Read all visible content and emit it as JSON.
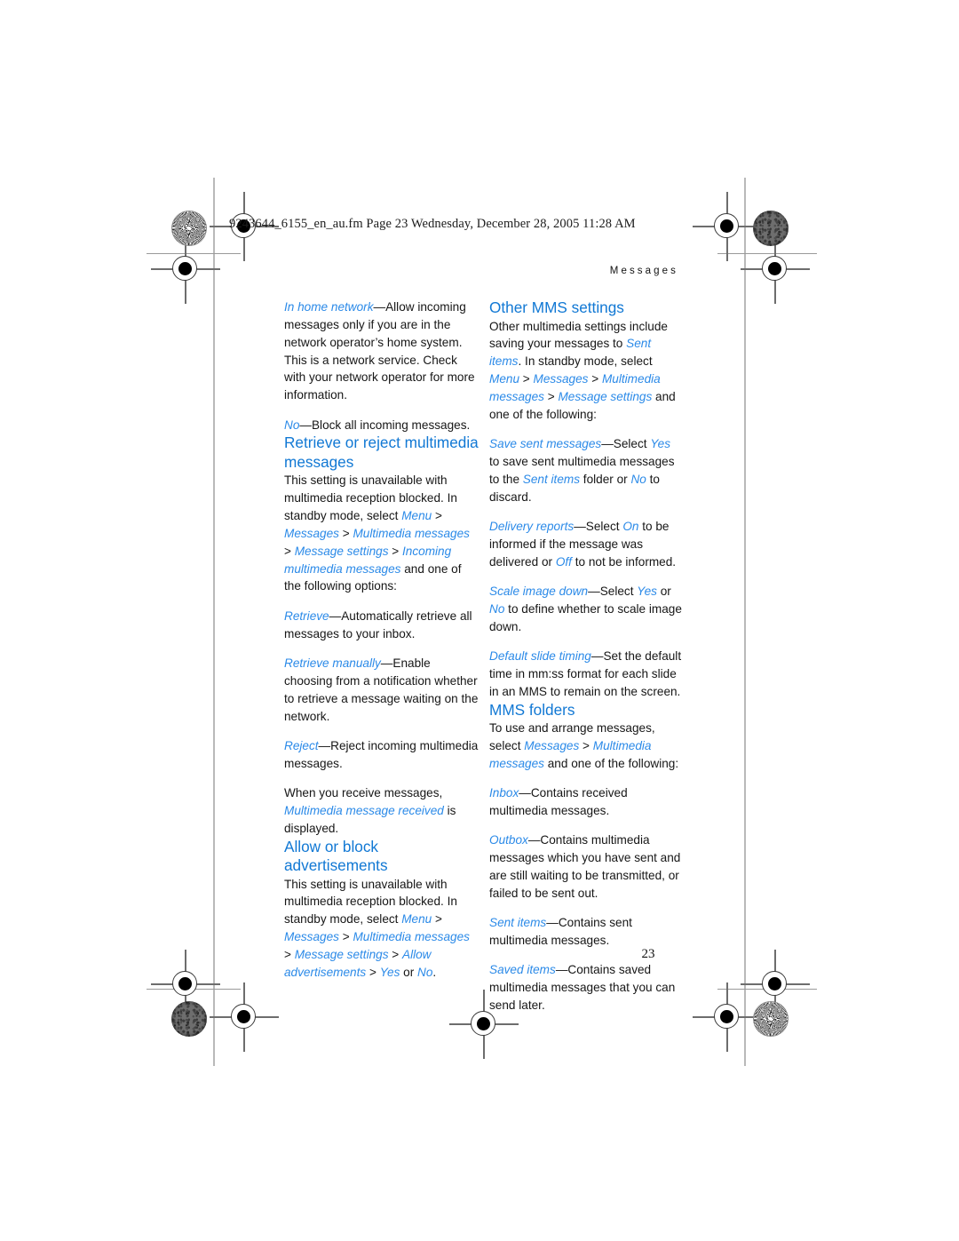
{
  "scan": {
    "header_line": "9243644_6155_en_au.fm  Page 23  Wednesday, December 28, 2005  11:28 AM"
  },
  "page": {
    "running_head": "Messages",
    "folio": "23"
  },
  "left_column": {
    "blocks": [
      {
        "type": "paragraph",
        "runs": [
          {
            "style": "ui",
            "text": "In home network"
          },
          {
            "style": "plain",
            "text": "—Allow incoming messages only if you are in the network operator’s home system. This is a network service. Check with your network operator for more information."
          }
        ]
      },
      {
        "type": "paragraph",
        "spaced": true,
        "runs": [
          {
            "style": "ui",
            "text": "No"
          },
          {
            "style": "plain",
            "text": "—Block all incoming messages."
          }
        ]
      },
      {
        "type": "heading",
        "text": "Retrieve or reject multimedia messages"
      },
      {
        "type": "paragraph",
        "runs": [
          {
            "style": "plain",
            "text": "This setting is unavailable with multimedia reception blocked. In standby mode, select "
          },
          {
            "style": "ui",
            "text": "Menu"
          },
          {
            "style": "sep",
            "text": " > "
          },
          {
            "style": "ui",
            "text": "Messages"
          },
          {
            "style": "sep",
            "text": " > "
          },
          {
            "style": "ui",
            "text": "Multimedia messages"
          },
          {
            "style": "sep",
            "text": " > "
          },
          {
            "style": "ui",
            "text": "Message settings"
          },
          {
            "style": "sep",
            "text": " > "
          },
          {
            "style": "ui",
            "text": "Incoming multimedia messages"
          },
          {
            "style": "plain",
            "text": " and one of the following options:"
          }
        ]
      },
      {
        "type": "paragraph",
        "spaced": true,
        "runs": [
          {
            "style": "ui",
            "text": "Retrieve"
          },
          {
            "style": "plain",
            "text": "—Automatically retrieve all messages to your inbox."
          }
        ]
      },
      {
        "type": "paragraph",
        "spaced": true,
        "runs": [
          {
            "style": "ui",
            "text": "Retrieve manually"
          },
          {
            "style": "plain",
            "text": "—Enable choosing from a notification whether to retrieve a message waiting on the network."
          }
        ]
      },
      {
        "type": "paragraph",
        "spaced": true,
        "runs": [
          {
            "style": "ui",
            "text": "Reject"
          },
          {
            "style": "plain",
            "text": "—Reject incoming multimedia messages."
          }
        ]
      },
      {
        "type": "paragraph",
        "spaced": true,
        "runs": [
          {
            "style": "plain",
            "text": "When you receive messages, "
          },
          {
            "style": "ui",
            "text": "Multimedia message received"
          },
          {
            "style": "plain",
            "text": " is displayed."
          }
        ]
      },
      {
        "type": "heading",
        "text": "Allow or block advertisements"
      },
      {
        "type": "paragraph",
        "runs": [
          {
            "style": "plain",
            "text": "This setting is unavailable with multimedia reception blocked. In standby mode, select "
          },
          {
            "style": "ui",
            "text": "Menu"
          },
          {
            "style": "sep",
            "text": " > "
          },
          {
            "style": "ui",
            "text": "Messages"
          },
          {
            "style": "sep",
            "text": " > "
          },
          {
            "style": "ui",
            "text": "Multimedia messages"
          },
          {
            "style": "sep",
            "text": " > "
          },
          {
            "style": "ui",
            "text": "Message settings"
          },
          {
            "style": "sep",
            "text": " > "
          },
          {
            "style": "ui",
            "text": "Allow advertisements"
          },
          {
            "style": "sep",
            "text": " > "
          },
          {
            "style": "ui",
            "text": "Yes"
          },
          {
            "style": "plain",
            "text": " or "
          },
          {
            "style": "ui",
            "text": "No"
          },
          {
            "style": "plain",
            "text": "."
          }
        ]
      }
    ]
  },
  "right_column": {
    "blocks": [
      {
        "type": "heading",
        "first": true,
        "text": "Other MMS settings"
      },
      {
        "type": "paragraph",
        "runs": [
          {
            "style": "plain",
            "text": "Other multimedia settings include saving your messages to "
          },
          {
            "style": "ui",
            "text": "Sent items"
          },
          {
            "style": "plain",
            "text": ". In standby mode, select "
          },
          {
            "style": "ui",
            "text": "Menu"
          },
          {
            "style": "sep",
            "text": " > "
          },
          {
            "style": "ui",
            "text": "Messages"
          },
          {
            "style": "sep",
            "text": " > "
          },
          {
            "style": "ui",
            "text": "Multimedia messages"
          },
          {
            "style": "sep",
            "text": " > "
          },
          {
            "style": "ui",
            "text": "Message settings"
          },
          {
            "style": "plain",
            "text": " and one of the following:"
          }
        ]
      },
      {
        "type": "paragraph",
        "spaced": true,
        "runs": [
          {
            "style": "ui",
            "text": "Save sent messages"
          },
          {
            "style": "plain",
            "text": "—Select "
          },
          {
            "style": "ui",
            "text": "Yes"
          },
          {
            "style": "plain",
            "text": " to save sent multimedia messages to the "
          },
          {
            "style": "ui",
            "text": "Sent items"
          },
          {
            "style": "plain",
            "text": " folder or "
          },
          {
            "style": "ui",
            "text": "No"
          },
          {
            "style": "plain",
            "text": " to discard."
          }
        ]
      },
      {
        "type": "paragraph",
        "spaced": true,
        "runs": [
          {
            "style": "ui",
            "text": "Delivery reports"
          },
          {
            "style": "plain",
            "text": "—Select "
          },
          {
            "style": "ui",
            "text": "On"
          },
          {
            "style": "plain",
            "text": " to be informed if the message was delivered or "
          },
          {
            "style": "ui",
            "text": "Off"
          },
          {
            "style": "plain",
            "text": " to not be informed."
          }
        ]
      },
      {
        "type": "paragraph",
        "spaced": true,
        "runs": [
          {
            "style": "ui",
            "text": "Scale image down"
          },
          {
            "style": "plain",
            "text": "—Select "
          },
          {
            "style": "ui",
            "text": "Yes"
          },
          {
            "style": "plain",
            "text": " or "
          },
          {
            "style": "ui",
            "text": "No"
          },
          {
            "style": "plain",
            "text": " to define whether to scale image down."
          }
        ]
      },
      {
        "type": "paragraph",
        "spaced": true,
        "runs": [
          {
            "style": "ui",
            "text": "Default slide timing"
          },
          {
            "style": "plain",
            "text": "—Set the default time in mm:ss format for each slide in an MMS to remain on the screen."
          }
        ]
      },
      {
        "type": "heading",
        "text": "MMS folders"
      },
      {
        "type": "paragraph",
        "runs": [
          {
            "style": "plain",
            "text": "To use and arrange messages, select "
          },
          {
            "style": "ui",
            "text": "Messages"
          },
          {
            "style": "sep",
            "text": " > "
          },
          {
            "style": "ui",
            "text": "Multimedia messages"
          },
          {
            "style": "plain",
            "text": " and one of the following:"
          }
        ]
      },
      {
        "type": "paragraph",
        "spaced": true,
        "runs": [
          {
            "style": "ui",
            "text": "Inbox"
          },
          {
            "style": "plain",
            "text": "—Contains received multimedia messages."
          }
        ]
      },
      {
        "type": "paragraph",
        "spaced": true,
        "runs": [
          {
            "style": "ui",
            "text": "Outbox"
          },
          {
            "style": "plain",
            "text": "—Contains multimedia messages which you have sent and are still waiting to be transmitted, or failed to be sent out."
          }
        ]
      },
      {
        "type": "paragraph",
        "spaced": true,
        "runs": [
          {
            "style": "ui",
            "text": "Sent items"
          },
          {
            "style": "plain",
            "text": "—Contains sent multimedia messages."
          }
        ]
      },
      {
        "type": "paragraph",
        "spaced": true,
        "runs": [
          {
            "style": "ui",
            "text": "Saved items"
          },
          {
            "style": "plain",
            "text": "—Contains saved multimedia messages that you can send later."
          }
        ]
      }
    ]
  },
  "colors": {
    "heading_blue": "#1178d4",
    "ui_term_blue": "#2b8ae8",
    "body_black": "#161616",
    "guide_gray": "#b9b9b9"
  }
}
